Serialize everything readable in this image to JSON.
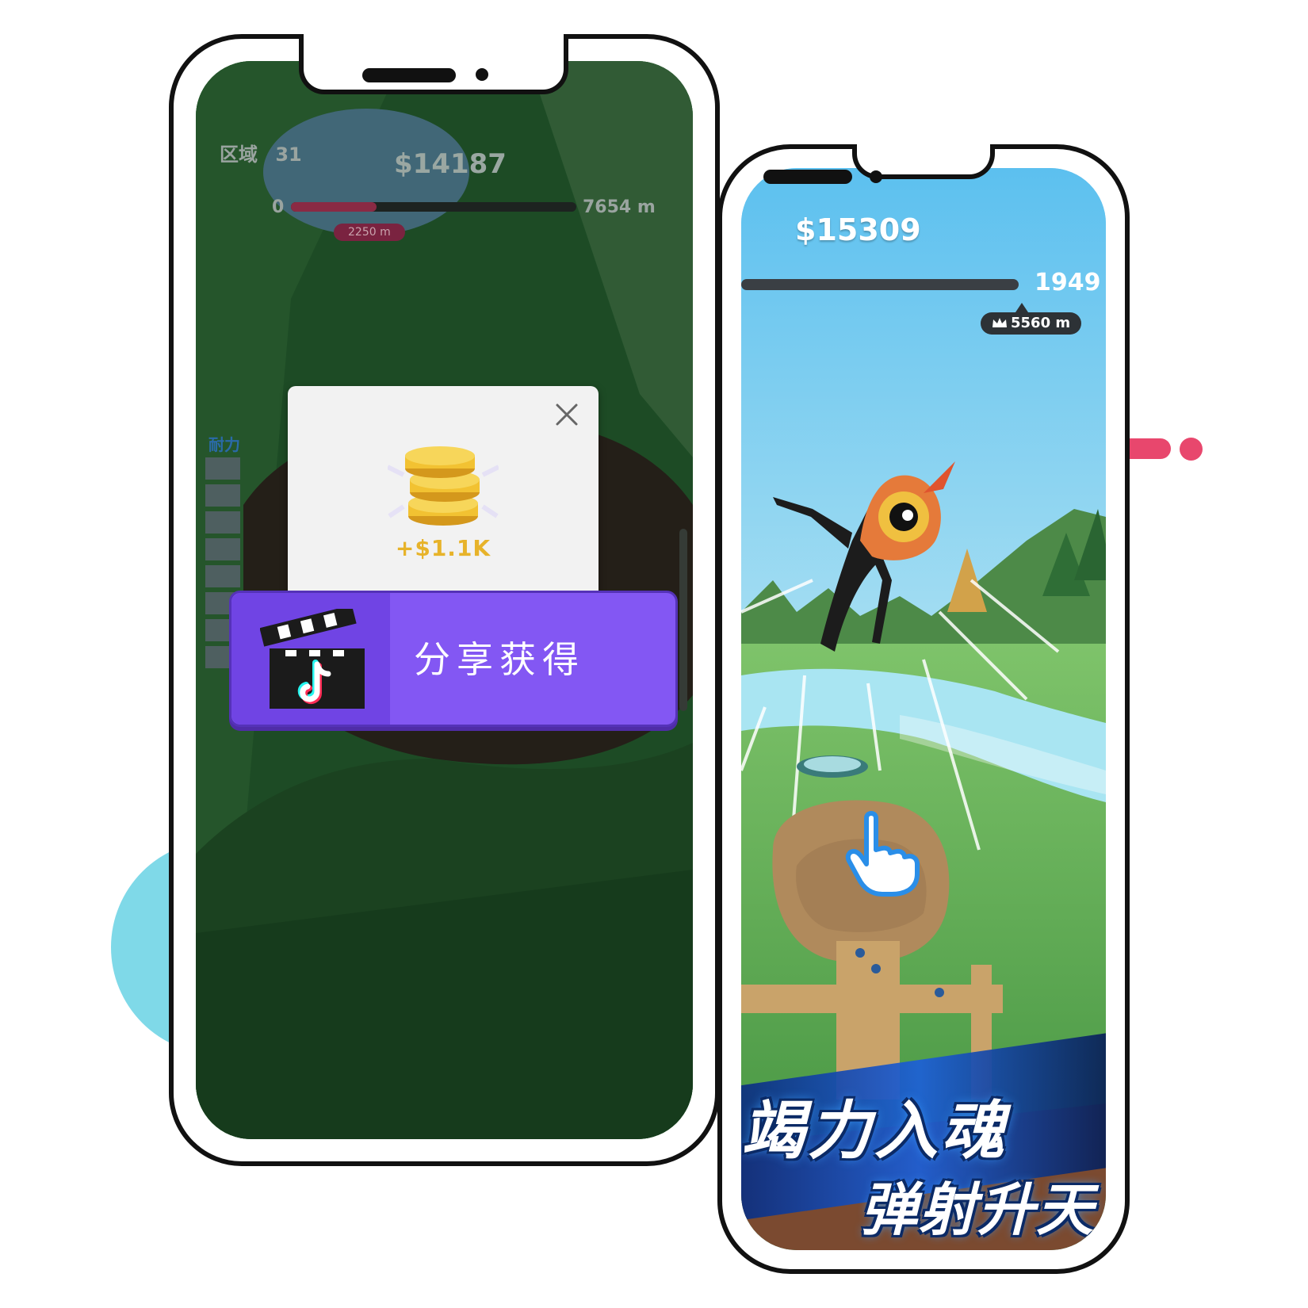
{
  "left_phone": {
    "zone_label": "区域",
    "zone_number": "31",
    "money": "$14187",
    "distance_start": "0",
    "distance_end": "7654 m",
    "progress_marker": "2250 m",
    "progress_fraction": 0.3,
    "stamina_label": "耐力",
    "reward_popup": {
      "reward_amount": "+$1.1K",
      "share_button_label": "分享获得",
      "close_icon": "close-icon",
      "coin_icon": "coin-stack-icon",
      "share_icon": "tiktok-clapperboard-icon"
    }
  },
  "right_phone": {
    "money": "$15309",
    "distance": "1949 m",
    "best_distance": "5560 m",
    "best_icon": "crown-icon",
    "banner_title": "竭力入魂",
    "banner_subtitle": "弹射升天",
    "tap_hint_icon": "pointing-hand-icon"
  },
  "colors": {
    "accent_pink": "#e8476d",
    "accent_cyan": "#7fd9e8",
    "share_button": "#8357f3",
    "reward_gold": "#e7b32a"
  }
}
